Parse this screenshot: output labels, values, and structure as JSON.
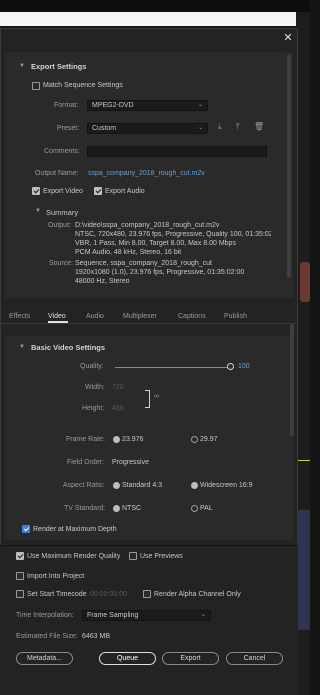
{
  "close_label": "✕",
  "export_settings": {
    "header": "Export Settings",
    "match_sequence": "Match Sequence Settings",
    "format_label": "Format:",
    "format_value": "MPEG2-DVD",
    "preset_label": "Preset:",
    "preset_value": "Custom",
    "comments_label": "Comments:",
    "output_name_label": "Output Name:",
    "output_name_value": "sspa_company_2018_rough_cut.m2v",
    "export_video": "Export Video",
    "export_audio": "Export Audio"
  },
  "summary": {
    "header": "Summary",
    "output_label": "Output:",
    "output_lines": [
      "D:\\video\\sspa_company_2018_rough_cut.m2v",
      "NTSC, 720x480, 23.976 fps, Progressive, Quality 100, 01:35:02...",
      "VBR, 1 Pass, Min 8.00, Target 8.00, Max 8.00 Mbps",
      "PCM Audio, 48 kHz, Stereo, 16 bit"
    ],
    "source_label": "Source:",
    "source_lines": [
      "Sequence, sspa_company_2018_rough_cut",
      "1920x1080 (1.0), 23.976 fps, Progressive, 01:35:02:00",
      "48000 Hz, Stereo"
    ]
  },
  "tabs": [
    "Effects",
    "Video",
    "Audio",
    "Multiplexer",
    "Captions",
    "Publish"
  ],
  "basic_video": {
    "header": "Basic Video Settings",
    "quality_label": "Quality:",
    "quality_value": "100",
    "width_label": "Width:",
    "width_value": "720",
    "height_label": "Height:",
    "height_value": "480",
    "frame_rate_label": "Frame Rate:",
    "frame_rate_opt1": "23.976",
    "frame_rate_opt2": "29.97",
    "field_order_label": "Field Order:",
    "field_order_value": "Progressive",
    "aspect_label": "Aspect Ratio:",
    "aspect_opt1": "Standard 4:3",
    "aspect_opt2": "Widescreen 16:9",
    "tv_label": "TV Standard:",
    "tv_opt1": "NTSC",
    "tv_opt2": "PAL",
    "render_max_depth": "Render at Maximum Depth"
  },
  "bottom": {
    "use_max_render": "Use Maximum Render Quality",
    "use_previews": "Use Previews",
    "import_project": "Import Into Project",
    "set_start_tc": "Set Start Timecode",
    "start_tc_value": "00:00:00:00",
    "render_alpha": "Render Alpha Channel Only",
    "time_interp_label": "Time Interpolation:",
    "time_interp_value": "Frame Sampling",
    "est_size_label": "Estimated File Size:",
    "est_size_value": "6463 MB"
  },
  "buttons": {
    "metadata": "Metadata...",
    "queue": "Queue",
    "export": "Export",
    "cancel": "Cancel"
  },
  "colors": {
    "accent": "#3d7fd6",
    "link": "#6b9fd8",
    "background": "#232323"
  }
}
